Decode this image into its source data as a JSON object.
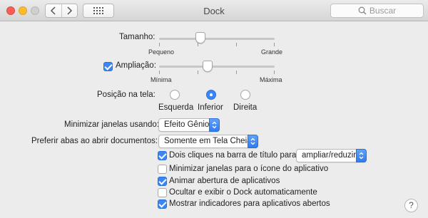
{
  "window": {
    "title": "Dock"
  },
  "search": {
    "placeholder": "Buscar"
  },
  "size": {
    "label": "Tamanho:",
    "min_label": "Pequeno",
    "max_label": "Grande",
    "value_fraction": 0.36
  },
  "magnification": {
    "label": "Ampliação:",
    "checked": true,
    "min_label": "Mínima",
    "max_label": "Máxima",
    "value_fraction": 0.42
  },
  "position": {
    "label": "Posição na tela:",
    "options": [
      {
        "label": "Esquerda",
        "selected": false
      },
      {
        "label": "Inferior",
        "selected": true
      },
      {
        "label": "Direita",
        "selected": false
      }
    ]
  },
  "minimize": {
    "label": "Minimizar janelas usando:",
    "value": "Efeito Gênio"
  },
  "tabs": {
    "label": "Preferir abas ao abrir documentos:",
    "value": "Somente em Tela Cheia"
  },
  "options": [
    {
      "label": "Dois cliques na barra de título para",
      "checked": true
    },
    {
      "label": "Minimizar janelas para o ícone do aplicativo",
      "checked": false
    },
    {
      "label": "Animar abertura de aplicativos",
      "checked": true
    },
    {
      "label": "Ocultar e exibir o Dock automaticamente",
      "checked": false
    },
    {
      "label": "Mostrar indicadores para aplicativos abertos",
      "checked": true
    }
  ],
  "double_click_action": {
    "value": "ampliar/reduzir"
  },
  "help": {
    "label": "?"
  },
  "colors": {
    "accent": "#3b86f7",
    "background": "#ececec"
  }
}
